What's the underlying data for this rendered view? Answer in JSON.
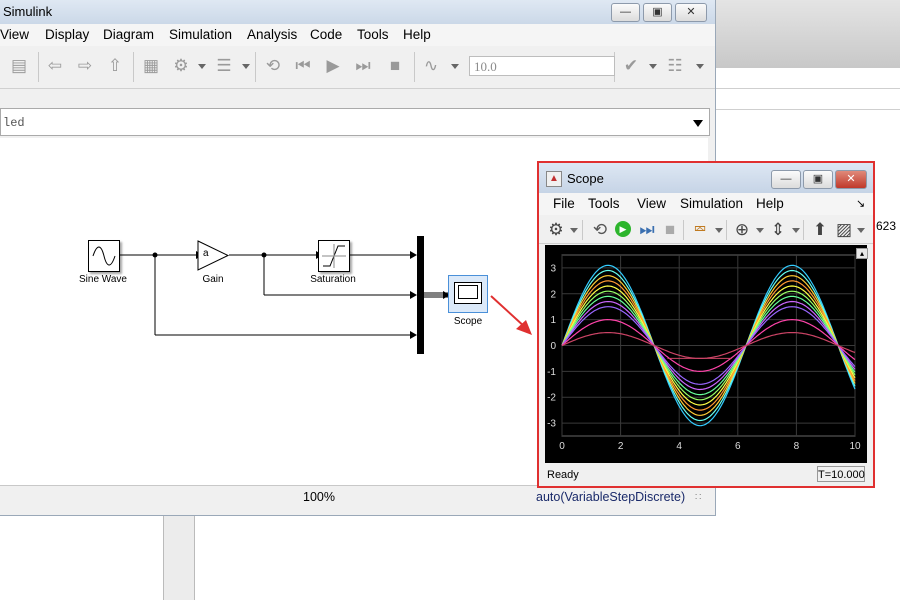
{
  "desktop": {
    "side_text": "623"
  },
  "simulink": {
    "title": "Simulink",
    "menu": [
      "View",
      "Display",
      "Diagram",
      "Simulation",
      "Analysis",
      "Code",
      "Tools",
      "Help"
    ],
    "stop_time": "10.0",
    "model_path": "led",
    "status": {
      "zoom": "100%",
      "solver": "auto(VariableStepDiscrete)"
    },
    "blocks": {
      "sine": "Sine Wave",
      "gain": "Gain",
      "gain_symbol": "a",
      "saturation": "Saturation",
      "scope": "Scope"
    }
  },
  "scope": {
    "title": "Scope",
    "menu": [
      "File",
      "Tools",
      "View",
      "Simulation",
      "Help"
    ],
    "status_left": "Ready",
    "status_right": "T=10.000"
  },
  "chart_data": {
    "type": "line",
    "title": "",
    "xlabel": "",
    "ylabel": "",
    "xlim": [
      0,
      10
    ],
    "ylim": [
      -3.5,
      3.5
    ],
    "xticks": [
      "0",
      "2",
      "4",
      "6",
      "8",
      "10"
    ],
    "yticks": [
      "3",
      "2",
      "1",
      "0",
      "-1",
      "-2",
      "-3"
    ],
    "grid": true,
    "background": "#000000",
    "series": [
      {
        "function": "y = A*sin(x)",
        "amplitude": 3.1,
        "color": "#33ccff"
      },
      {
        "function": "y = A*sin(x)",
        "amplitude": 2.9,
        "color": "#66ffee"
      },
      {
        "function": "y = A*sin(x)",
        "amplitude": 2.7,
        "color": "#ffcc33"
      },
      {
        "function": "y = A*sin(x)",
        "amplitude": 2.5,
        "color": "#ff9933"
      },
      {
        "function": "y = A*sin(x)",
        "amplitude": 2.3,
        "color": "#ffff44"
      },
      {
        "function": "y = A*sin(x)",
        "amplitude": 2.1,
        "color": "#99ff66"
      },
      {
        "function": "y = A*sin(x)",
        "amplitude": 1.9,
        "color": "#66ff99"
      },
      {
        "function": "y = A*sin(x)",
        "amplitude": 1.7,
        "color": "#cc66ff"
      },
      {
        "function": "y = A*sin(x)",
        "amplitude": 1.5,
        "color": "#9966ff"
      },
      {
        "function": "y = A*sin(x)",
        "amplitude": 1.0,
        "color": "#ff44aa"
      },
      {
        "function": "y = A*sin(x)",
        "amplitude": 0.5,
        "color": "#cc4466"
      }
    ]
  }
}
